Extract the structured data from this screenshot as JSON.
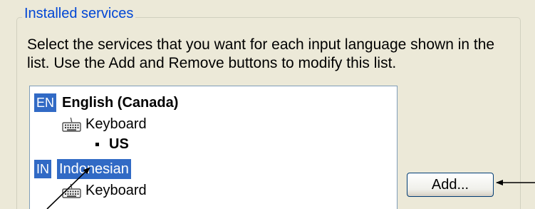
{
  "groupbox": {
    "title": "Installed services",
    "description": "Select the services that you want for each input language shown in the list. Use the Add and Remove buttons to modify this list."
  },
  "services_list": {
    "items": [
      {
        "code": "EN",
        "language": "English (Canada)",
        "service": "Keyboard",
        "layout": "US",
        "selected": false
      },
      {
        "code": "IN",
        "language": "Indonesian",
        "service": "Keyboard",
        "selected": true
      }
    ]
  },
  "buttons": {
    "add_label": "Add..."
  },
  "icons": {
    "keyboard": "keyboard-icon",
    "bullet": "bullet-icon"
  },
  "colors": {
    "selection": "#316ac5",
    "group_title": "#0046d5",
    "panel_bg": "#ece9d8"
  }
}
